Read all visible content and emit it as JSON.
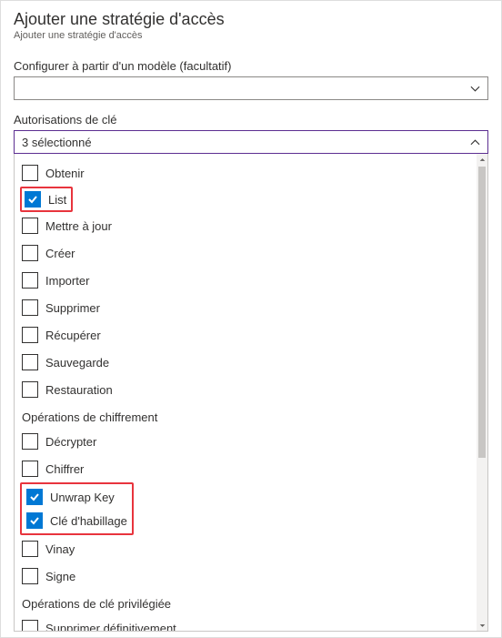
{
  "header": {
    "title": "Ajouter une stratégie d'accès",
    "subtitle": "Ajouter une stratégie d'accès"
  },
  "template": {
    "label": "Configurer à partir d'un modèle (facultatif)",
    "value": ""
  },
  "keyPerm": {
    "label": "Autorisations de clé",
    "summary": "3 sélectionné"
  },
  "options": {
    "obtenir": "Obtenir",
    "list": "List",
    "mettre": "Mettre à jour",
    "creer": "Créer",
    "importer": "Importer",
    "supprimer": "Supprimer",
    "recuperer": "Récupérer",
    "sauvegarde": "Sauvegarde",
    "restauration": "Restauration",
    "groupCrypto": "Opérations de chiffrement",
    "decrypter": "Décrypter",
    "chiffrer": "Chiffrer",
    "unwrap": "Unwrap Key",
    "wrap": "Clé d'habillage",
    "vinay": "Vinay",
    "signe": "Signe",
    "groupPriv": "Opérations de clé privilégiée",
    "suppDef": "Supprimer définitivement"
  }
}
